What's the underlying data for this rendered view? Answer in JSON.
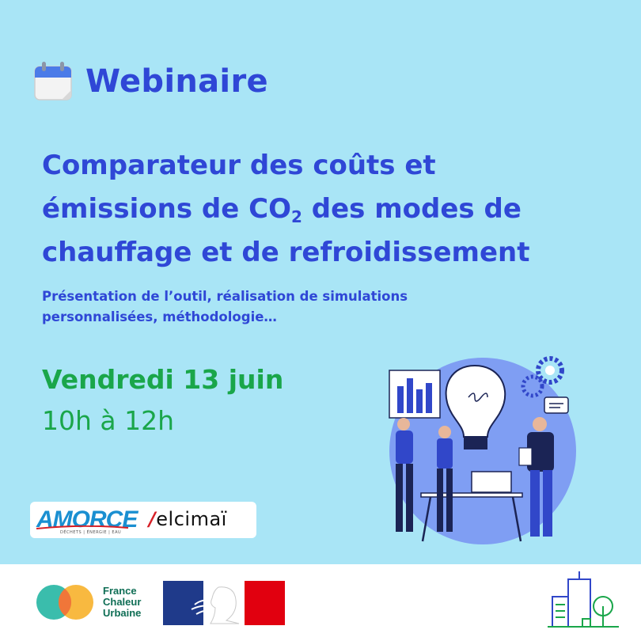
{
  "header": {
    "title": "Webinaire",
    "icon": "calendar-icon"
  },
  "event": {
    "title_line1": "Comparateur des coûts et",
    "title_line2_before": "émissions de CO",
    "title_line2_sub": "2",
    "title_line2_after": " des modes de",
    "title_line3": "chauffage et de refroidissement",
    "subtitle_line1": "Présentation de l’outil, réalisation de simulations",
    "subtitle_line2": "personnalisées, méthodologie…",
    "date": "Vendredi 13 juin",
    "time": "10h à 12h"
  },
  "partners": {
    "amorce": "AMORCE",
    "amorce_tagline": "DÉCHETS | ÉNERGIE | EAU",
    "elcimai_slash": "/",
    "elcimai": "elcimaï"
  },
  "footer": {
    "fcu_line1": "France",
    "fcu_line2": "Chaleur",
    "fcu_line3": "Urbaine"
  },
  "colors": {
    "background": "#a9e5f6",
    "primary_blue": "#2f47d6",
    "accent_green": "#1aa64a"
  }
}
